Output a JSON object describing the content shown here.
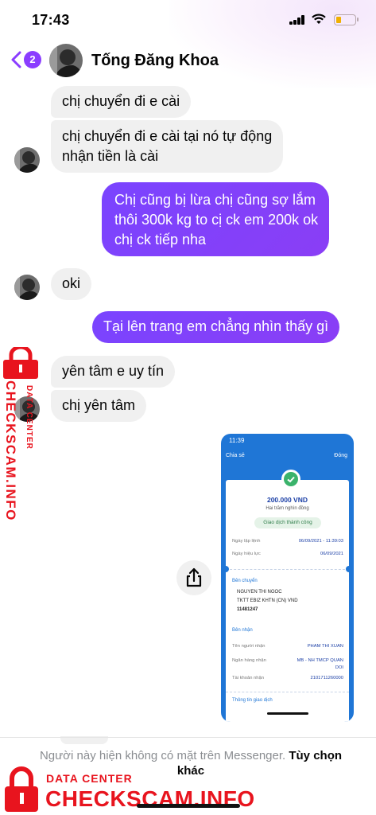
{
  "status_bar": {
    "time": "17:43"
  },
  "header": {
    "unread_count": "2",
    "contact_name": "Tống Đăng Khoa"
  },
  "messages": [
    {
      "dir": "in",
      "text": "chị chuyển đi e cài"
    },
    {
      "dir": "in",
      "text": "chị chuyển đi e cài tại nó tự động",
      "text2": "nhận tiền là cài"
    },
    {
      "dir": "out",
      "text": "Chị cũng bị lừa chị cũng sợ lắm",
      "text2": "thôi 300k kg to cị ck em 200k ok",
      "text3": "chị ck tiếp nha"
    },
    {
      "dir": "in",
      "text": "oki"
    },
    {
      "dir": "out",
      "text": "Tại lên trang em chẳng nhìn thấy gì"
    },
    {
      "dir": "in",
      "text": "yên tâm e uy tín"
    },
    {
      "dir": "in",
      "text": "chị yên tâm"
    }
  ],
  "receipt": {
    "time": "11:39",
    "share": "Chia sẻ",
    "close": "Đóng",
    "amount": "200.000 VND",
    "amount_words": "Hai trăm nghìn đồng",
    "status": "Giao dịch thành công",
    "created_label": "Ngày lập lệnh",
    "created_value": "06/09/2021 - 11:39:03",
    "effective_label": "Ngày hiệu lực",
    "effective_value": "06/09/2021",
    "sender_section": "Bên chuyển",
    "sender_name": "NGUYEN THI NGOC",
    "sender_account_type": "TKTT EBIZ KHTN (CN) VND",
    "sender_account": "11481247",
    "receiver_section": "Bên nhận",
    "receiver_name_label": "Tên người nhận",
    "receiver_name": "PHAM THI XUAN",
    "receiver_bank_label": "Ngân hàng nhận",
    "receiver_bank": "MB - NH TMCP QUAN",
    "receiver_bank2": "DOI",
    "receiver_account_label": "Tài khoản nhận",
    "receiver_account": "2101711260000",
    "info_section": "Thông tin giao dịch"
  },
  "footer": {
    "message": "Người này hiện không có mặt trên Messenger.",
    "option": "Tùy chọn khác"
  },
  "watermark": {
    "small": "DATA CENTER",
    "big": "CHECKSCAM.INFO"
  },
  "colors": {
    "outgoing": "#7a44ff",
    "incoming": "#f0f0f0",
    "badge": "#8b3dff",
    "watermark": "#e8141e"
  },
  "icons": [
    "back-chevron-icon",
    "signal-icon",
    "wifi-icon",
    "battery-icon",
    "share-icon",
    "lock-icon",
    "check-icon"
  ]
}
